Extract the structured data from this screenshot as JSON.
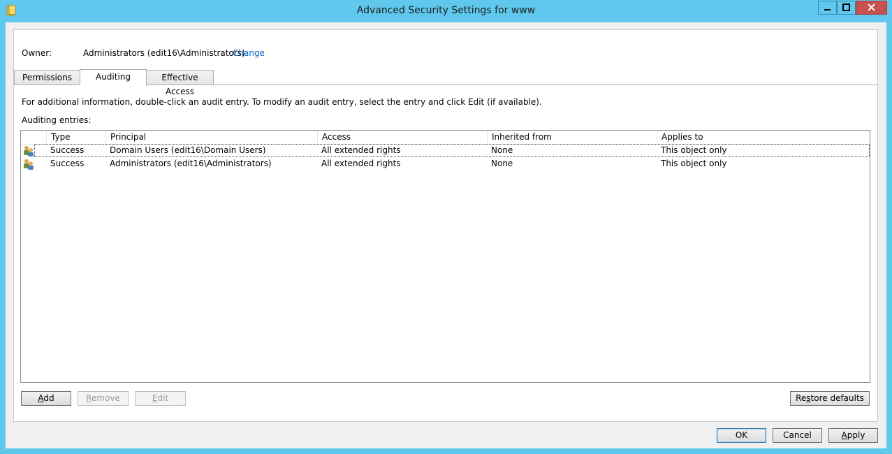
{
  "window": {
    "title": "Advanced Security Settings for www",
    "icon": "folder-icon",
    "title_bar_color": "#5fc8ec",
    "close_button_color": "#c75050"
  },
  "owner": {
    "label": "Owner:",
    "value": "Administrators (edit16\\Administrators)",
    "change_link": "Change"
  },
  "tabs": [
    {
      "label": "Permissions",
      "active": false
    },
    {
      "label": "Auditing",
      "active": true
    },
    {
      "label": "Effective Access",
      "active": false
    }
  ],
  "info_text": "For additional information, double-click an audit entry. To modify an audit entry, select the entry and click Edit (if available).",
  "entries_label": "Auditing entries:",
  "table": {
    "columns": [
      "Type",
      "Principal",
      "Access",
      "Inherited from",
      "Applies to"
    ],
    "rows": [
      {
        "icon": "users-group-icon",
        "type": "Success",
        "principal": "Domain Users (edit16\\Domain Users)",
        "access": "All extended rights",
        "inherited_from": "None",
        "applies_to": "This object only",
        "focused": true
      },
      {
        "icon": "users-group-icon",
        "type": "Success",
        "principal": "Administrators (edit16\\Administrators)",
        "access": "All extended rights",
        "inherited_from": "None",
        "applies_to": "This object only",
        "focused": false
      }
    ]
  },
  "buttons": {
    "add": {
      "label_prefix": "",
      "mnemonic": "A",
      "label_suffix": "dd",
      "enabled": true
    },
    "remove": {
      "label_prefix": "",
      "mnemonic": "R",
      "label_suffix": "emove",
      "enabled": false
    },
    "edit": {
      "label_prefix": "",
      "mnemonic": "E",
      "label_suffix": "dit",
      "enabled": false
    },
    "restore": {
      "label_prefix": "Re",
      "mnemonic": "s",
      "label_suffix": "tore defaults",
      "enabled": true
    },
    "ok": {
      "label": "OK"
    },
    "cancel": {
      "label": "Cancel"
    },
    "apply": {
      "label_prefix": "",
      "mnemonic": "A",
      "label_suffix": "pply",
      "enabled": true
    }
  }
}
